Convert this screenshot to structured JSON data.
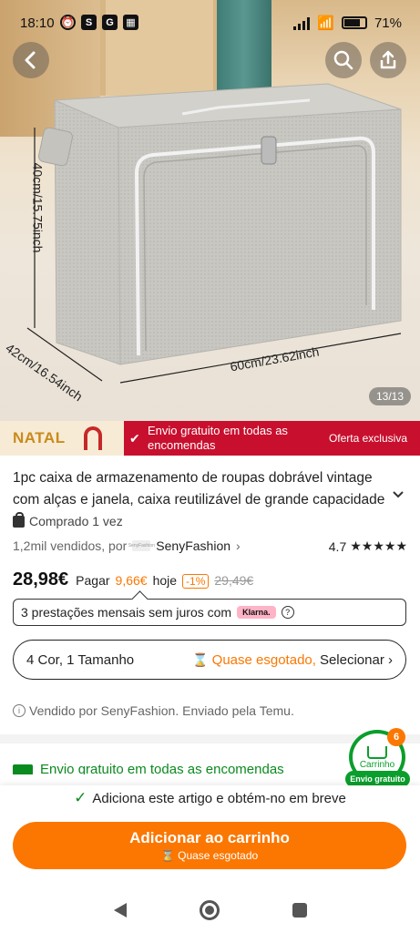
{
  "status_bar": {
    "time": "18:10",
    "battery": "71%"
  },
  "hero": {
    "dimension_height": "40cm/15.75inch",
    "dimension_depth": "42cm/16.54inch",
    "dimension_width": "60cm/23.62inch",
    "page_indicator": "13/13"
  },
  "promo": {
    "natal": "NATAL",
    "message": "Envio gratuito em todas as encomendas",
    "offer": "Oferta exclusiva"
  },
  "product": {
    "title": "1pc caixa de armazenamento de roupas dobrável vintage com alças e janela, caixa reutilizável de grande capacidade",
    "bought": "Comprado 1 vez",
    "sold_count": "1,2mil vendidos, por",
    "shop_logo": "SenyFashion",
    "shop_name": "SenyFashion",
    "rating": "4.7",
    "stars": "★★★★★",
    "price": "28,98€",
    "pay_label": "Pagar",
    "pay_value": "9,66€",
    "pay_when": "hoje",
    "discount": "-1%",
    "old_price": "29,49€"
  },
  "klarna": {
    "text": "3 prestações mensais sem juros com",
    "badge": "Klarna."
  },
  "variant": {
    "label": "4 Cor, 1 Tamanho",
    "stock": "Quase esgotado,",
    "select": "Selecionar"
  },
  "sold_by": "Vendido por SenyFashion. Enviado pela Temu.",
  "shipping_row": "Envio gratuito em todas as encomendas",
  "cart": {
    "count": "6",
    "label": "Carrinho",
    "badge": "Envio gratuito"
  },
  "bottom": {
    "confirm": "Adiciona este artigo e obtém-no em breve",
    "add_label": "Adicionar ao carrinho",
    "add_sub": "Quase esgotado"
  },
  "colors": {
    "accent": "#fb7701",
    "green": "#0a8a1f",
    "promo_red": "#c8102e"
  }
}
